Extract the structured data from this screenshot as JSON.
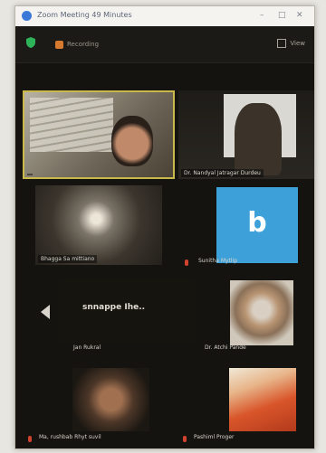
{
  "window": {
    "title": "Zoom Meeting 49 Minutes",
    "controls": [
      "–",
      "□",
      "✕"
    ]
  },
  "toolbar": {
    "recording_label": "Recording",
    "view_label": "View"
  },
  "participants": [
    {
      "name": "",
      "muted": false
    },
    {
      "name": "Dr. Nandyal Jatragar Durdeu",
      "muted": false
    },
    {
      "name": "Bhagga Sa mittiano",
      "muted": false
    },
    {
      "name": "Sunitha Mytlip",
      "muted": true
    },
    {
      "name": "Jan Rukral",
      "muted": false
    },
    {
      "name": "Dr. Atchi Pande",
      "muted": false
    },
    {
      "name": "Ma, rushbab Rhyt suvil",
      "muted": true
    },
    {
      "name": "Pashiml Proger",
      "muted": true
    }
  ],
  "avatar_letter": "b",
  "screen_share_label": "snnappe Ihe..",
  "colors": {
    "accent": "#3ea0d8",
    "active_border": "#c9b94a",
    "record": "#d57a2e"
  }
}
